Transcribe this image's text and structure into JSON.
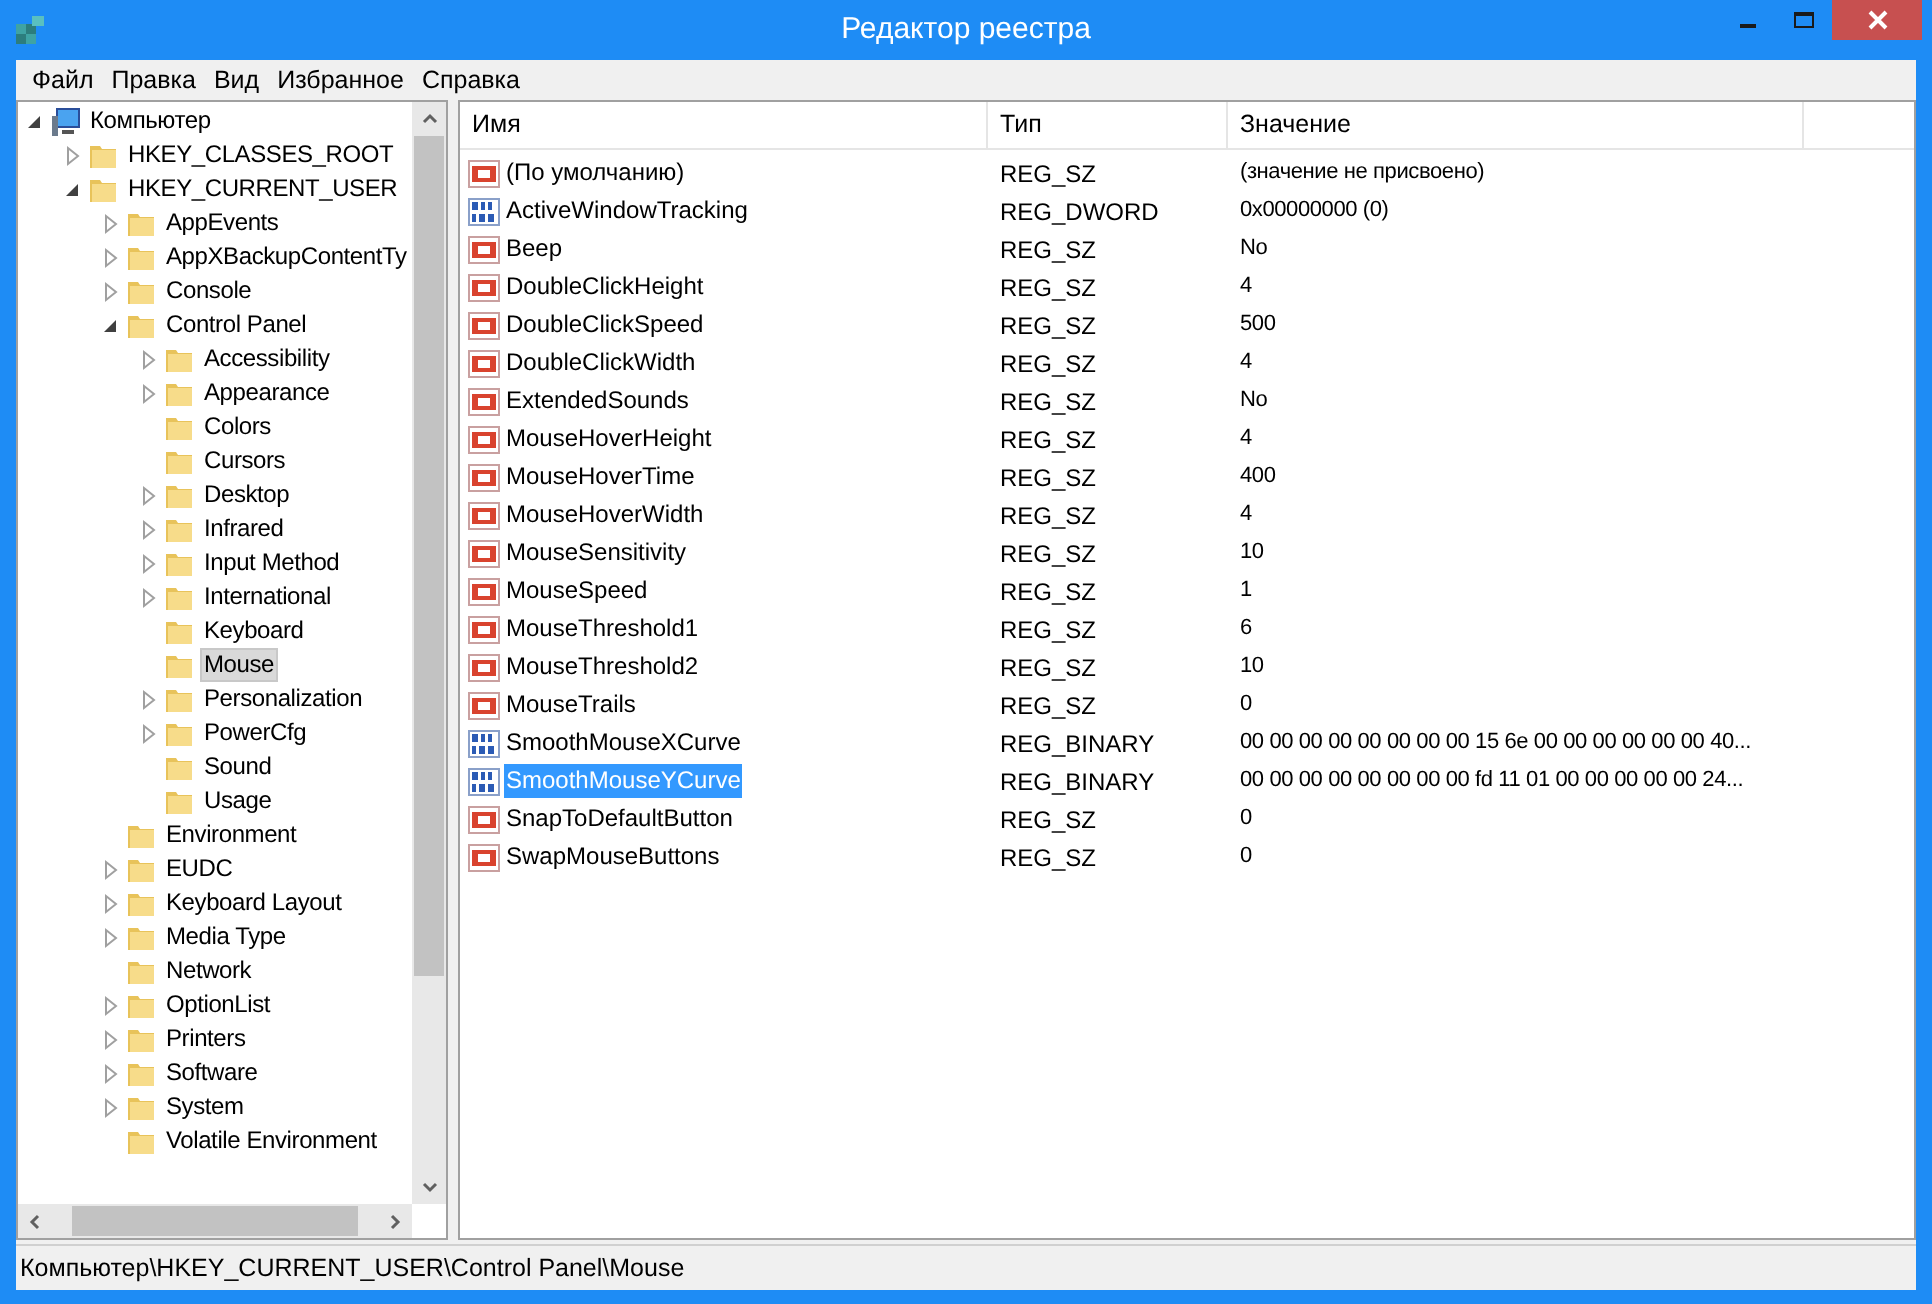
{
  "window": {
    "title": "Редактор реестра"
  },
  "menu": [
    "Файл",
    "Правка",
    "Вид",
    "Избранное",
    "Справка"
  ],
  "tree": [
    {
      "label": "Компьютер",
      "kind": "computer",
      "expanded": true,
      "selected": false,
      "children": [
        {
          "label": "HKEY_CLASSES_ROOT",
          "expanded": false,
          "selected": false
        },
        {
          "label": "HKEY_CURRENT_USER",
          "expanded": true,
          "selected": false,
          "children": [
            {
              "label": "AppEvents",
              "expanded": false,
              "selected": false
            },
            {
              "label": "AppXBackupContentTy",
              "expanded": false,
              "selected": false
            },
            {
              "label": "Console",
              "expanded": false,
              "selected": false
            },
            {
              "label": "Control Panel",
              "expanded": true,
              "selected": false,
              "children": [
                {
                  "label": "Accessibility",
                  "expanded": false,
                  "selected": false
                },
                {
                  "label": "Appearance",
                  "expanded": false,
                  "selected": false
                },
                {
                  "label": "Colors",
                  "selected": false
                },
                {
                  "label": "Cursors",
                  "selected": false
                },
                {
                  "label": "Desktop",
                  "expanded": false,
                  "selected": false
                },
                {
                  "label": "Infrared",
                  "expanded": false,
                  "selected": false
                },
                {
                  "label": "Input Method",
                  "expanded": false,
                  "selected": false
                },
                {
                  "label": "International",
                  "expanded": false,
                  "selected": false
                },
                {
                  "label": "Keyboard",
                  "selected": false
                },
                {
                  "label": "Mouse",
                  "selected": true
                },
                {
                  "label": "Personalization",
                  "expanded": false,
                  "selected": false
                },
                {
                  "label": "PowerCfg",
                  "expanded": false,
                  "selected": false
                },
                {
                  "label": "Sound",
                  "selected": false
                },
                {
                  "label": "Usage",
                  "selected": false
                }
              ]
            },
            {
              "label": "Environment",
              "selected": false
            },
            {
              "label": "EUDC",
              "expanded": false,
              "selected": false
            },
            {
              "label": "Keyboard Layout",
              "expanded": false,
              "selected": false
            },
            {
              "label": "Media Type",
              "expanded": false,
              "selected": false
            },
            {
              "label": "Network",
              "selected": false
            },
            {
              "label": "OptionList",
              "expanded": false,
              "selected": false
            },
            {
              "label": "Printers",
              "expanded": false,
              "selected": false
            },
            {
              "label": "Software",
              "expanded": false,
              "selected": false
            },
            {
              "label": "System",
              "expanded": false,
              "selected": false
            },
            {
              "label": "Volatile Environment",
              "selected": false
            }
          ]
        }
      ]
    }
  ],
  "table": {
    "columns": [
      "Имя",
      "Тип",
      "Значение"
    ],
    "rows": [
      {
        "kind": "string",
        "name": "(По умолчанию)",
        "type": "REG_SZ",
        "value": "(значение не присвоено)",
        "selected": false
      },
      {
        "kind": "binary",
        "name": "ActiveWindowTracking",
        "type": "REG_DWORD",
        "value": "0x00000000 (0)",
        "selected": false
      },
      {
        "kind": "string",
        "name": "Beep",
        "type": "REG_SZ",
        "value": "No",
        "selected": false
      },
      {
        "kind": "string",
        "name": "DoubleClickHeight",
        "type": "REG_SZ",
        "value": "4",
        "selected": false
      },
      {
        "kind": "string",
        "name": "DoubleClickSpeed",
        "type": "REG_SZ",
        "value": "500",
        "selected": false
      },
      {
        "kind": "string",
        "name": "DoubleClickWidth",
        "type": "REG_SZ",
        "value": "4",
        "selected": false
      },
      {
        "kind": "string",
        "name": "ExtendedSounds",
        "type": "REG_SZ",
        "value": "No",
        "selected": false
      },
      {
        "kind": "string",
        "name": "MouseHoverHeight",
        "type": "REG_SZ",
        "value": "4",
        "selected": false
      },
      {
        "kind": "string",
        "name": "MouseHoverTime",
        "type": "REG_SZ",
        "value": "400",
        "selected": false
      },
      {
        "kind": "string",
        "name": "MouseHoverWidth",
        "type": "REG_SZ",
        "value": "4",
        "selected": false
      },
      {
        "kind": "string",
        "name": "MouseSensitivity",
        "type": "REG_SZ",
        "value": "10",
        "selected": false
      },
      {
        "kind": "string",
        "name": "MouseSpeed",
        "type": "REG_SZ",
        "value": "1",
        "selected": false
      },
      {
        "kind": "string",
        "name": "MouseThreshold1",
        "type": "REG_SZ",
        "value": "6",
        "selected": false
      },
      {
        "kind": "string",
        "name": "MouseThreshold2",
        "type": "REG_SZ",
        "value": "10",
        "selected": false
      },
      {
        "kind": "string",
        "name": "MouseTrails",
        "type": "REG_SZ",
        "value": "0",
        "selected": false
      },
      {
        "kind": "binary",
        "name": "SmoothMouseXCurve",
        "type": "REG_BINARY",
        "value": "00 00 00 00 00 00 00 00 15 6e 00 00 00 00 00 00 40...",
        "selected": false
      },
      {
        "kind": "binary",
        "name": "SmoothMouseYCurve",
        "type": "REG_BINARY",
        "value": "00 00 00 00 00 00 00 00 fd 11 01 00 00 00 00 00 24...",
        "selected": true
      },
      {
        "kind": "string",
        "name": "SnapToDefaultButton",
        "type": "REG_SZ",
        "value": "0",
        "selected": false
      },
      {
        "kind": "string",
        "name": "SwapMouseButtons",
        "type": "REG_SZ",
        "value": "0",
        "selected": false
      }
    ]
  },
  "status_bar": "Компьютер\\HKEY_CURRENT_USER\\Control Panel\\Mouse"
}
